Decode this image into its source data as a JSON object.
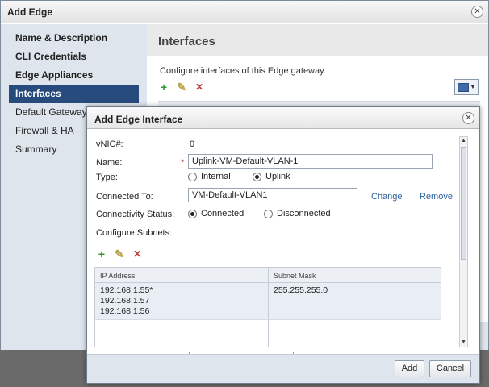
{
  "outer": {
    "title": "Add Edge",
    "close_glyph": "✕",
    "sidebar": [
      {
        "label": "Name & Description",
        "bold": true
      },
      {
        "label": "CLI Credentials",
        "bold": true
      },
      {
        "label": "Edge Appliances",
        "bold": true
      },
      {
        "label": "Interfaces",
        "active": true
      },
      {
        "label": "Default Gateway"
      },
      {
        "label": "Firewall & HA"
      },
      {
        "label": "Summary"
      }
    ],
    "heading": "Interfaces",
    "description": "Configure interfaces of this Edge gateway."
  },
  "modal": {
    "title": "Add Edge Interface",
    "close_glyph": "✕",
    "vnic_label": "vNIC#:",
    "vnic_value": "0",
    "name_label": "Name:",
    "name_required": "*",
    "name_value": "Uplink-VM-Default-VLAN-1",
    "type_label": "Type:",
    "type_options": [
      "Internal",
      "Uplink"
    ],
    "type_selected": "Uplink",
    "connected_label": "Connected To:",
    "connected_value": "VM-Default-VLAN1",
    "change_link": "Change",
    "remove_link": "Remove",
    "status_label": "Connectivity Status:",
    "status_options": [
      "Connected",
      "Disconnected"
    ],
    "status_selected": "Connected",
    "subnets_label": "Configure Subnets:",
    "table": {
      "headers": [
        "IP Address",
        "Subnet Mask"
      ],
      "rows": [
        {
          "ips": [
            "192.168.1.55*",
            "192.168.1.57",
            "192.168.1.56"
          ],
          "mask": "255.255.255.0"
        }
      ]
    },
    "add_button": "Add",
    "cancel_button": "Cancel"
  },
  "icons": {
    "add": "+",
    "edit": "✎",
    "delete": "✕"
  }
}
